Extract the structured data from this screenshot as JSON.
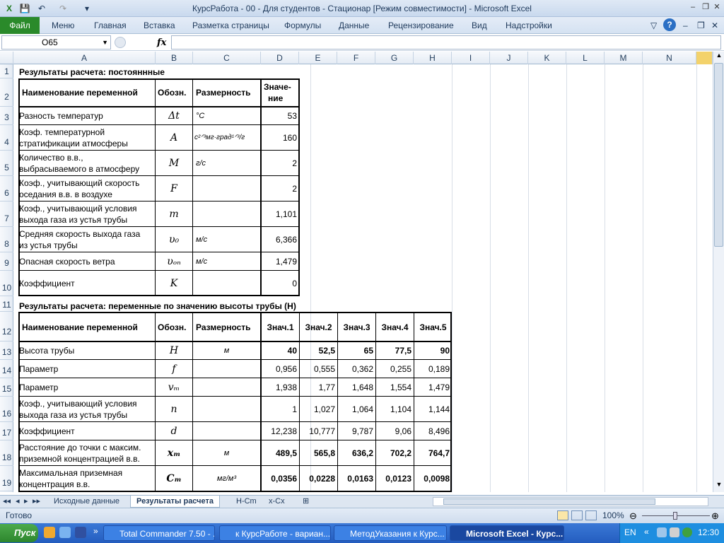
{
  "window": {
    "title": "КурсРабота - 00 - Для студентов - Стационар  [Режим совместимости]  -  Microsoft Excel"
  },
  "ribbon": {
    "file": "Файл",
    "tabs": [
      "Меню",
      "Главная",
      "Вставка",
      "Разметка страницы",
      "Формулы",
      "Данные",
      "Рецензирование",
      "Вид",
      "Надстройки"
    ]
  },
  "formula": {
    "namebox": "O65",
    "fx": "fx",
    "value": ""
  },
  "columns": [
    "A",
    "B",
    "C",
    "D",
    "E",
    "F",
    "G",
    "H",
    "I",
    "J",
    "K",
    "L",
    "M",
    "N"
  ],
  "rows": [
    "1",
    "2",
    "3",
    "4",
    "5",
    "6",
    "7",
    "8",
    "9",
    "10",
    "11",
    "12",
    "13",
    "14",
    "15",
    "16",
    "17",
    "18",
    "19"
  ],
  "table1": {
    "title": "Результаты расчета: постояннные",
    "headers": [
      "Наименование переменной",
      "Обозн.",
      "Размерность",
      "Значе-",
      "ние"
    ],
    "rows": [
      {
        "name1": "Разность температур",
        "name2": "",
        "sym": "Δt",
        "unit": "°C",
        "val": "53"
      },
      {
        "name1": "Коэф. температурной",
        "name2": "стратификации атмосферы",
        "sym": "A",
        "unit": "с²ᐟ³мг·град¹ᐟ³/г",
        "val": "160"
      },
      {
        "name1": "Количество в.в.,",
        "name2": "выбрасываемого в атмосферу",
        "sym": "M",
        "unit": "г/с",
        "val": "2"
      },
      {
        "name1": "Коэф., учитывающий скорость",
        "name2": "оседания в.в. в воздухе",
        "sym": "F",
        "unit": "",
        "val": "2"
      },
      {
        "name1": "Коэф., учитывающий условия",
        "name2": "выхода газа из устья трубы",
        "sym": "m",
        "unit": "",
        "val": "1,101"
      },
      {
        "name1": "Средняя скорость выхода газа",
        "name2": "из устья трубы",
        "sym": "υ₀",
        "unit": "м/с",
        "val": "6,366"
      },
      {
        "name1": "Опасная скорость ветра",
        "name2": "",
        "sym": "υₒₙ",
        "unit": "м/с",
        "val": "1,479"
      },
      {
        "name1": "Коэффициент",
        "name2": "",
        "sym": "K",
        "unit": "",
        "val": "0"
      }
    ]
  },
  "table2": {
    "title": "Результаты расчета: переменные по значению высоты трубы (H)",
    "headers": [
      "Наименование переменной",
      "Обозн.",
      "Размерность",
      "Знач.1",
      "Знач.2",
      "Знач.3",
      "Знач.4",
      "Знач.5"
    ],
    "rows": [
      {
        "name1": "Высота трубы",
        "name2": "",
        "sym": "H",
        "unit": "м",
        "vals": [
          "40",
          "52,5",
          "65",
          "77,5",
          "90"
        ],
        "bold": true
      },
      {
        "name1": "Параметр",
        "name2": "",
        "sym": "f",
        "unit": "",
        "vals": [
          "0,956",
          "0,555",
          "0,362",
          "0,255",
          "0,189"
        ],
        "bold": false
      },
      {
        "name1": "Параметр",
        "name2": "",
        "sym": "vₘ",
        "unit": "",
        "vals": [
          "1,938",
          "1,77",
          "1,648",
          "1,554",
          "1,479"
        ],
        "bold": false
      },
      {
        "name1": "Коэф., учитывающий условия",
        "name2": "выхода газа из устья трубы",
        "sym": "n",
        "unit": "",
        "vals": [
          "1",
          "1,027",
          "1,064",
          "1,104",
          "1,144"
        ],
        "bold": false
      },
      {
        "name1": "Коэффициент",
        "name2": "",
        "sym": "d",
        "unit": "",
        "vals": [
          "12,238",
          "10,777",
          "9,787",
          "9,06",
          "8,496"
        ],
        "bold": false
      },
      {
        "name1": "Расстояние до точки с максим.",
        "name2": "приземной концентрацией в.в.",
        "sym": "xₘ",
        "unit": "м",
        "vals": [
          "489,5",
          "565,8",
          "636,2",
          "702,2",
          "764,7"
        ],
        "bold": true
      },
      {
        "name1": "Максимальная приземная",
        "name2": "концентрация в.в.",
        "sym": "Cₘ",
        "unit": "мг/м³",
        "vals": [
          "0,0356",
          "0,0228",
          "0,0163",
          "0,0123",
          "0,0098"
        ],
        "bold": true
      }
    ]
  },
  "sheets": [
    "Исходные данные",
    "Результаты расчета",
    "H-Cm",
    "x-Cx"
  ],
  "status": {
    "ready": "Готово",
    "zoom": "100%"
  },
  "taskbar": {
    "start": "Пуск",
    "items": [
      "Total Commander 7.50 - ...",
      "к КурсРаботе - вариан...",
      "МетодУказания к Курс...",
      "Microsoft Excel - Курс..."
    ],
    "lang": "EN",
    "clock": "12:30"
  }
}
